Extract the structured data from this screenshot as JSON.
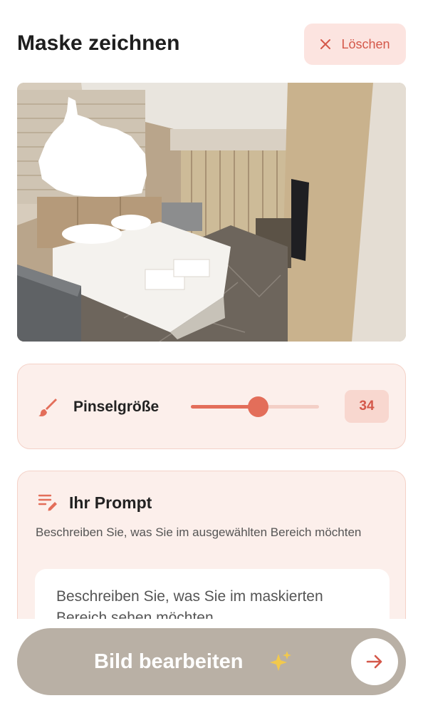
{
  "header": {
    "title": "Maske zeichnen",
    "clear_label": "Löschen"
  },
  "photo": {
    "icon": "hotel-room-photo"
  },
  "brush": {
    "label": "Pinselgröße",
    "value": "34",
    "slider_fraction": 0.52,
    "icon": "paintbrush-icon"
  },
  "prompt": {
    "title": "Ihr Prompt",
    "description": "Beschreiben Sie, was Sie im ausgewählten Bereich möchten",
    "placeholder": "Beschreiben Sie, was Sie im maskierten Bereich sehen möchten",
    "icon": "edit-list-icon"
  },
  "submit": {
    "label": "Bild bearbeiten",
    "sparkle_icon": "sparkle-icon",
    "arrow_icon": "arrow-right-icon"
  },
  "colors": {
    "accent": "#e36e5a",
    "card_bg": "#fcefeb",
    "button_bg": "#b9b0a5"
  }
}
